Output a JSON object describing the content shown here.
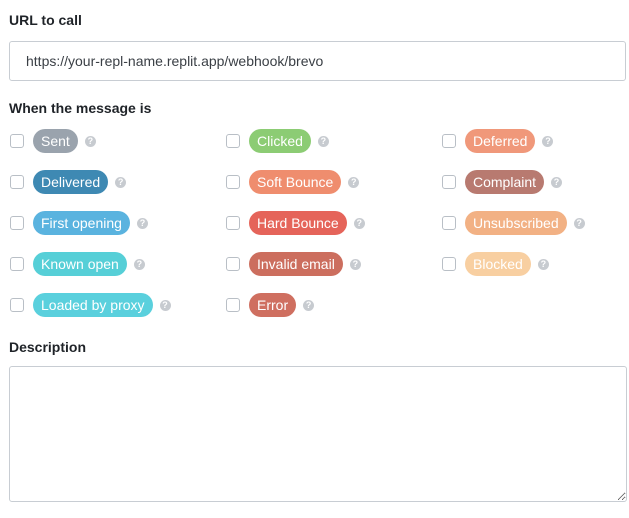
{
  "url_section": {
    "label": "URL to call",
    "value": "https://your-repl-name.replit.app/webhook/brevo"
  },
  "events_section": {
    "label": "When the message is",
    "events": [
      {
        "label": "Sent",
        "color": "#9aa3ad",
        "checked": false
      },
      {
        "label": "Clicked",
        "color": "#8ccc74",
        "checked": false
      },
      {
        "label": "Deferred",
        "color": "#f0987a",
        "checked": false
      },
      {
        "label": "Delivered",
        "color": "#3e89b3",
        "checked": false
      },
      {
        "label": "Soft Bounce",
        "color": "#ef8d6e",
        "checked": false
      },
      {
        "label": "Complaint",
        "color": "#b87a70",
        "checked": false
      },
      {
        "label": "First opening",
        "color": "#5ab3df",
        "checked": false
      },
      {
        "label": "Hard Bounce",
        "color": "#e5645a",
        "checked": false
      },
      {
        "label": "Unsubscribed",
        "color": "#f2b184",
        "checked": false
      },
      {
        "label": "Known open",
        "color": "#56cfd7",
        "checked": false
      },
      {
        "label": "Invalid email",
        "color": "#cc6e5e",
        "checked": false
      },
      {
        "label": "Blocked",
        "color": "#f8cfa1",
        "checked": false
      },
      {
        "label": "Loaded by proxy",
        "color": "#5ad0dd",
        "checked": false
      },
      {
        "label": "Error",
        "color": "#cf6f60",
        "checked": false
      }
    ]
  },
  "description_section": {
    "label": "Description",
    "value": ""
  }
}
